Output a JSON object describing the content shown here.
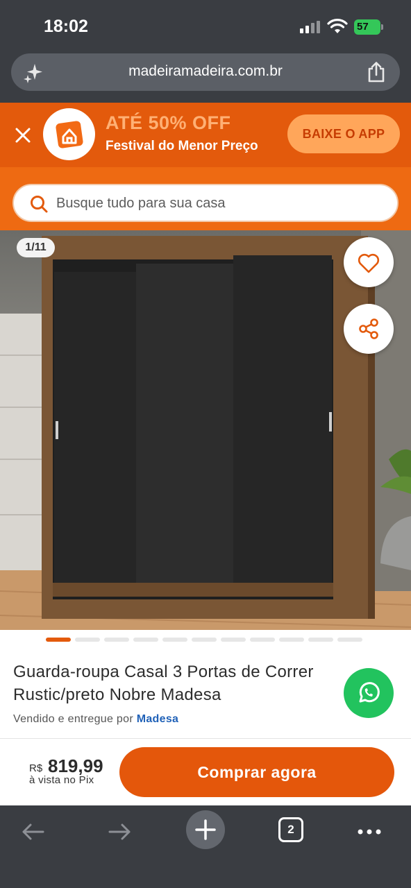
{
  "status_bar": {
    "time": "18:02",
    "battery": "57"
  },
  "url_bar": {
    "url": "madeiramadeira.com.br",
    "left_icon": "sparkles-icon",
    "right_icon": "share-icon"
  },
  "promo": {
    "headline": "ATÉ 50% OFF",
    "subheadline": "Festival do Menor Preço",
    "cta": "BAIXE O APP",
    "close_icon": "close-icon",
    "logo_icon": "house-logo-icon"
  },
  "search": {
    "placeholder": "Busque tudo para sua casa"
  },
  "product": {
    "image_counter": "1/11",
    "image_count": 11,
    "active_image": 1,
    "title": "Guarda-roupa Casal 3 Portas de Correr Rustic/preto Nobre Madesa",
    "seller_prefix": "Vendido e entregue por",
    "seller_name": "Madesa"
  },
  "purchase": {
    "currency": "R$",
    "price": "819,99",
    "price_note": "à vista no Pix",
    "buy_label": "Comprar agora"
  },
  "browser_toolbar": {
    "tabs_count": "2"
  },
  "colors": {
    "brand_orange": "#e35a0c",
    "promo_headline": "#ffb074",
    "whatsapp_green": "#22c35e",
    "seller_link": "#2162b8"
  }
}
